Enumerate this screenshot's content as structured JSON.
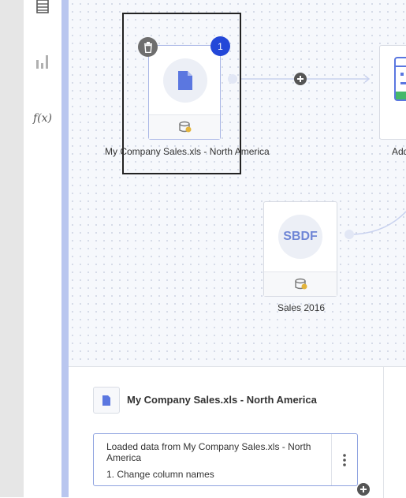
{
  "sidebar": {
    "tools": [
      {
        "icon": "table-icon"
      },
      {
        "icon": "bar-chart-icon"
      },
      {
        "icon": "function-icon",
        "text": "f(x)"
      }
    ]
  },
  "canvas": {
    "nodes": [
      {
        "label": "My Company Sales.xls - North America",
        "icon": "document-icon",
        "badge": "1",
        "selected": true
      },
      {
        "label": "Sales 2016",
        "icon_text": "SBDF"
      },
      {
        "label": "Add"
      }
    ],
    "connector_icon": "add-node-icon"
  },
  "panel": {
    "title": "My Company Sales.xls - North America",
    "step": {
      "text": "Loaded data from My Company Sales.xls - North America",
      "sub": "1. Change column names"
    }
  },
  "colors": {
    "accent": "#2347d8",
    "node_icon": "#5b77e0",
    "divider": "#b9c6ef",
    "sbdf": "#6f86d6"
  }
}
